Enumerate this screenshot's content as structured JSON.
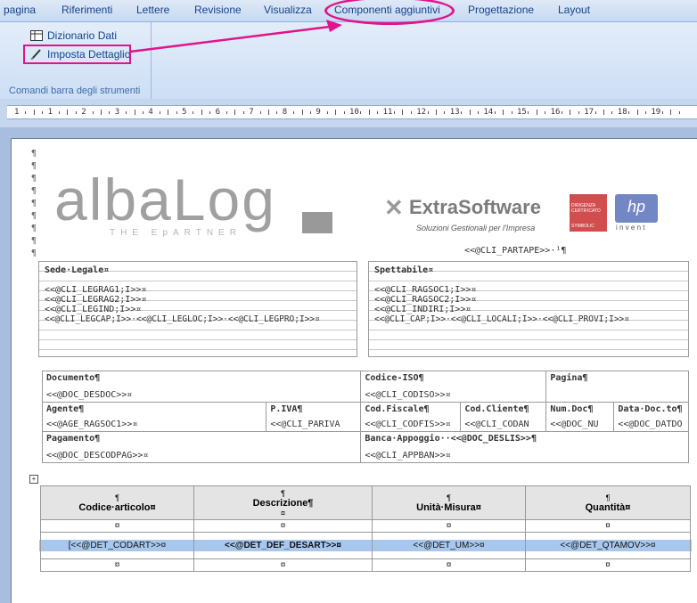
{
  "ribbon": {
    "tabs": [
      "pagina",
      "Riferimenti",
      "Lettere",
      "Revisione",
      "Visualizza",
      "Componenti aggiuntivi",
      "Progettazione",
      "Layout"
    ],
    "active_tab": "Componenti aggiuntivi",
    "buttons": {
      "dizionario": "Dizionario Dati",
      "imposta": "Imposta Dettaglio"
    },
    "group_label": "Comandi barra degli strumenti"
  },
  "ruler": {
    "labels": [
      "1",
      "1",
      "2",
      "3",
      "4",
      "5",
      "6",
      "7",
      "8",
      "9",
      "10",
      "11",
      "12",
      "13",
      "14",
      "15",
      "16",
      "17",
      "18",
      "19"
    ]
  },
  "header": {
    "logo_main": "albaLog",
    "logo_sub": "THE EpARTNER",
    "extra_name": "ExtraSoftware",
    "extra_tagline": "Soluzioni Gestionali per l'Impresa",
    "cert_text": "DIRIGENZA CERTIFICATO",
    "cert_symbol": "SYMBOLIC",
    "hp_logo": "hp",
    "hp_sub": "i n v e n t",
    "partape": "<<@CLI_PARTAPE>>·¹¶"
  },
  "sede": {
    "title": "Sede·Legale¤",
    "lines": [
      "<<@CLI_LEGRAG1;I>>¤",
      "<<@CLI_LEGRAG2;I>>¤",
      "<<@CLI_LEGIND;I>>¤",
      "<<@CLI_LEGCAP;I>>·<<@CLI_LEGLOC;I>>·<<@CLI_LEGPRO;I>>¤"
    ]
  },
  "spettabile": {
    "title": "Spettabile¤",
    "lines": [
      "<<@CLI_RAGSOC1;I>>¤",
      "<<@CLI_RAGSOC2;I>>¤",
      "<<@CLI_INDIRI;I>>¤",
      "<<@CLI_CAP;I>>·<<@CLI_LOCALI;I>>·<<@CLI_PROVI;I>>¤"
    ]
  },
  "docinfo": {
    "documento_label": "Documento¶",
    "documento_value": "<<@DOC_DESDOC>>¤",
    "codiso_label": "Codice-ISO¶",
    "codiso_value": "<<@CLI_CODISO>>¤",
    "pagina_label": "Pagina¶",
    "agente_label": "Agente¶",
    "agente_value": "<<@AGE_RAGSOC1>>¤",
    "piva_label": "P.IVA¶",
    "piva_value": "<<@CLI_PARIVA",
    "codfis_label": "Cod.Fiscale¶",
    "codfis_value": "<<@CLI_CODFIS>>¤",
    "codcli_label": "Cod.Cliente¶",
    "codcli_value": "<<@CLI_CODAN",
    "numdoc_label": "Num.Doc¶",
    "numdoc_value": "<<@DOC_NU",
    "datadoc_label": "Data·Doc.to¶",
    "datadoc_value": "<<@DOC_DATDO",
    "pagamento_label": "Pagamento¶",
    "pagamento_value": "<<@DOC_DESCODPAG>>¤",
    "banca_label": "Banca·Appoggio··<<@DOC_DESLIS>>¶",
    "banca_value": "<<@CLI_APPBAN>>¤"
  },
  "detail": {
    "headers": [
      "Codice·articolo¤",
      "Descrizione¶",
      "Unità·Misura¤",
      "Quantità¤"
    ],
    "row": [
      "[<<@DET_CODART>>¤",
      "<<@DET_DEF_DESART>>¤",
      "<<@DET_UM>>¤",
      "<<@DET_QTAMOV>>¤"
    ],
    "marker": "¤",
    "pilcrow": "¶"
  },
  "colors": {
    "highlight": "#e0148c",
    "band": "#a9c7ec"
  }
}
